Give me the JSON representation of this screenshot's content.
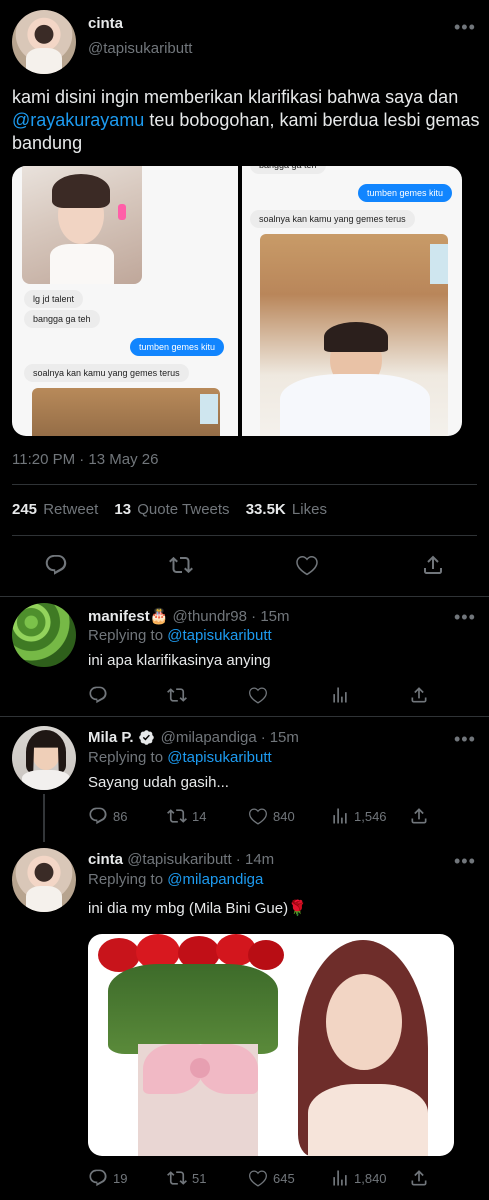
{
  "main_tweet": {
    "display_name": "cinta",
    "handle": "@tapisukaributt",
    "text_part1": "kami disini ingin memberikan klarifikasi bahwa saya dan ",
    "mention": "@rayakurayamu",
    "text_part2": " teu bobogohan, kami berdua lesbi gemas bandung",
    "timestamp": "11:20 PM · 13 May 26",
    "stats": {
      "retweets": "245",
      "retweets_label": "Retweet",
      "quotes": "13",
      "quotes_label": "Quote Tweets",
      "likes": "33.5K",
      "likes_label": "Likes"
    },
    "chat_left": {
      "msg1": "lg jd talent",
      "msg2": "bangga ga teh",
      "msg3": "tumben gemes kitu",
      "msg4": "soalnya kan kamu yang gemes terus"
    },
    "chat_right": {
      "msg0": "bangga ga teh",
      "msg1": "tumben gemes kitu",
      "msg2": "soalnya kan kamu yang gemes terus"
    }
  },
  "replies": [
    {
      "display_name": "manifest🎂",
      "handle": "@thundr98",
      "time": "15m",
      "replying_prefix": "Replying to",
      "replying_to": "@tapisukaributt",
      "text": "ini apa klarifikasinya anying"
    },
    {
      "display_name": "Mila P.",
      "handle": "@milapandiga",
      "time": "15m",
      "replying_prefix": "Replying to",
      "replying_to": "@tapisukaributt",
      "text": "Sayang udah gasih...",
      "counts": {
        "replies": "86",
        "retweets": "14",
        "likes": "840",
        "views": "1,546"
      }
    },
    {
      "display_name": "cinta",
      "handle": "@tapisukaributt",
      "time": "14m",
      "replying_prefix": "Replying to",
      "replying_to": "@milapandiga",
      "text": "ini dia my mbg (Mila Bini Gue)🌹",
      "counts": {
        "replies": "19",
        "retweets": "51",
        "likes": "645",
        "views": "1,840"
      }
    }
  ],
  "colors": {
    "background": "#000000",
    "text": "#e7e9ea",
    "muted": "#71767b",
    "link": "#1d9bf0",
    "divider": "#2f3336",
    "verified": "#e7e9ea"
  },
  "icons": [
    "reply-icon",
    "retweet-icon",
    "like-icon",
    "share-icon",
    "views-icon",
    "more-icon",
    "verified-icon"
  ]
}
